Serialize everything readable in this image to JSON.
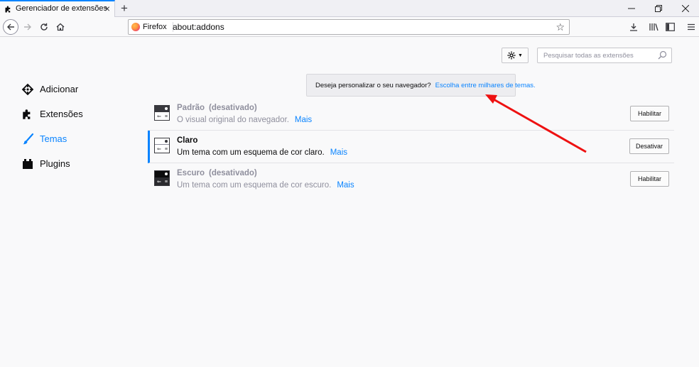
{
  "tab": {
    "title": "Gerenciador de extensões"
  },
  "toolbar": {
    "identity": "Firefox",
    "url": "about:addons"
  },
  "search": {
    "placeholder": "Pesquisar todas as extensões"
  },
  "sidebar": {
    "items": [
      {
        "label": "Adicionar",
        "icon": "get-addons-icon"
      },
      {
        "label": "Extensões",
        "icon": "puzzle-icon"
      },
      {
        "label": "Temas",
        "icon": "brush-icon",
        "selected": true
      },
      {
        "label": "Plugins",
        "icon": "plugin-icon"
      }
    ]
  },
  "banner": {
    "text": "Deseja personalizar o seu navegador?",
    "link": "Escolha entre milhares de temas."
  },
  "themes": [
    {
      "name": "Padrão",
      "status": "(desativado)",
      "description": "O visual original do navegador.",
      "more": "Mais",
      "action": "Habilitar"
    },
    {
      "name": "Claro",
      "status": "",
      "description": "Um tema com um esquema de cor claro.",
      "more": "Mais",
      "action": "Desativar"
    },
    {
      "name": "Escuro",
      "status": "(desativado)",
      "description": "Um tema com um esquema de cor escuro.",
      "more": "Mais",
      "action": "Habilitar"
    }
  ],
  "colors": {
    "accent": "#0a84ff",
    "annotation_arrow": "#ee1111"
  }
}
